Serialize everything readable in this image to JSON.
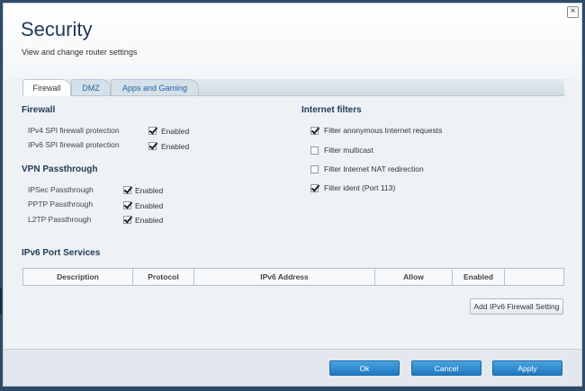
{
  "dialog": {
    "title": "Security",
    "subtitle": "View and change router settings",
    "close_glyph": "×"
  },
  "tabs": [
    {
      "label": "Firewall",
      "active": true
    },
    {
      "label": "DMZ",
      "active": false
    },
    {
      "label": "Apps and Gaming",
      "active": false
    }
  ],
  "firewall": {
    "title": "Firewall",
    "rows": [
      {
        "label": "IPv4 SPI firewall protection",
        "checked": true,
        "value": "Enabled"
      },
      {
        "label": "IPv6 SPI firewall protection",
        "checked": true,
        "value": "Enabled"
      }
    ]
  },
  "vpn": {
    "title": "VPN Passthrough",
    "rows": [
      {
        "label": "IPSec Passthrough",
        "checked": true,
        "value": "Enabled"
      },
      {
        "label": "PPTP Passthrough",
        "checked": true,
        "value": "Enabled"
      },
      {
        "label": "L2TP Passthrough",
        "checked": true,
        "value": "Enabled"
      }
    ]
  },
  "internet_filters": {
    "title": "Internet filters",
    "items": [
      {
        "label": "Filter anonymous Internet requests",
        "checked": true
      },
      {
        "label": "Filter multicast",
        "checked": false
      },
      {
        "label": "Filter Internet NAT redirection",
        "checked": false
      },
      {
        "label": "Filter ident (Port 113)",
        "checked": true
      }
    ]
  },
  "ipv6_ports": {
    "title": "IPv6 Port Services",
    "columns": [
      "Description",
      "Protocol",
      "IPv6 Address",
      "Allow",
      "Enabled",
      ""
    ],
    "add_button": "Add IPv6 Firewall Setting"
  },
  "footer": {
    "ok": "Ok",
    "cancel": "Cancel",
    "apply": "Apply"
  },
  "colors": {
    "accent": "#1f78c1",
    "title": "#1f3a55",
    "tab_link": "#1d64a8"
  }
}
